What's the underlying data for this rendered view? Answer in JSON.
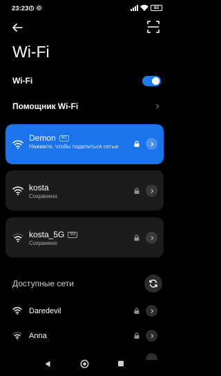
{
  "status_bar": {
    "time": "23:23",
    "battery": "92"
  },
  "page": {
    "title": "Wi-Fi"
  },
  "settings": {
    "wifi_label": "Wi-Fi",
    "wifi_enabled": true,
    "assistant_label": "Помощник Wi-Fi"
  },
  "saved_networks": [
    {
      "name": "Demon",
      "band": "5G",
      "status": "Нажмите, чтобы поделиться сетью",
      "connected": true,
      "secured": true
    },
    {
      "name": "kosta",
      "band": "",
      "status": "Сохранено",
      "connected": false,
      "secured": true
    },
    {
      "name": "kosta_5G",
      "band": "5G",
      "status": "Сохранено",
      "connected": false,
      "secured": true
    }
  ],
  "available": {
    "title": "Доступные сети",
    "networks": [
      {
        "name": "Daredevil",
        "secured": true
      },
      {
        "name": "Anna",
        "secured": true
      }
    ]
  },
  "colors": {
    "accent": "#1a7cef",
    "card": "#1c1c1e",
    "background": "#000000"
  }
}
